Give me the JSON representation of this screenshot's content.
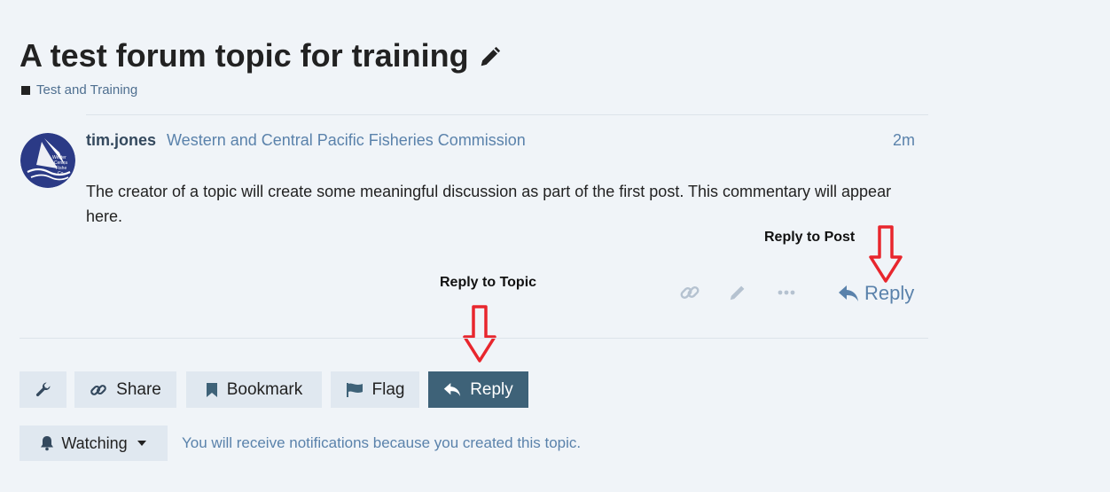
{
  "topic": {
    "title": "A test forum topic for training",
    "category": "Test and Training"
  },
  "post": {
    "username": "tim.jones",
    "organization": "Western and Central Pacific Fisheries Commission",
    "age": "2m",
    "body": "The creator of a topic will create some meaningful discussion as part of the first post. This commentary will appear here.",
    "avatar_text": [
      "Wester",
      "Centra",
      "Fishe",
      "Co"
    ],
    "reply_label": "Reply"
  },
  "annotations": {
    "reply_to_post": "Reply to Post",
    "reply_to_topic": "Reply to Topic",
    "arrow_color": "#e8262d"
  },
  "footer": {
    "share_label": "Share",
    "bookmark_label": "Bookmark",
    "flag_label": "Flag",
    "reply_label": "Reply",
    "watching_label": "Watching",
    "watching_note": "You will receive notifications because you created this topic."
  },
  "colors": {
    "primary_button": "#3e6278",
    "link_blue": "#5a82ab",
    "button_bg": "#e0e8f0"
  }
}
